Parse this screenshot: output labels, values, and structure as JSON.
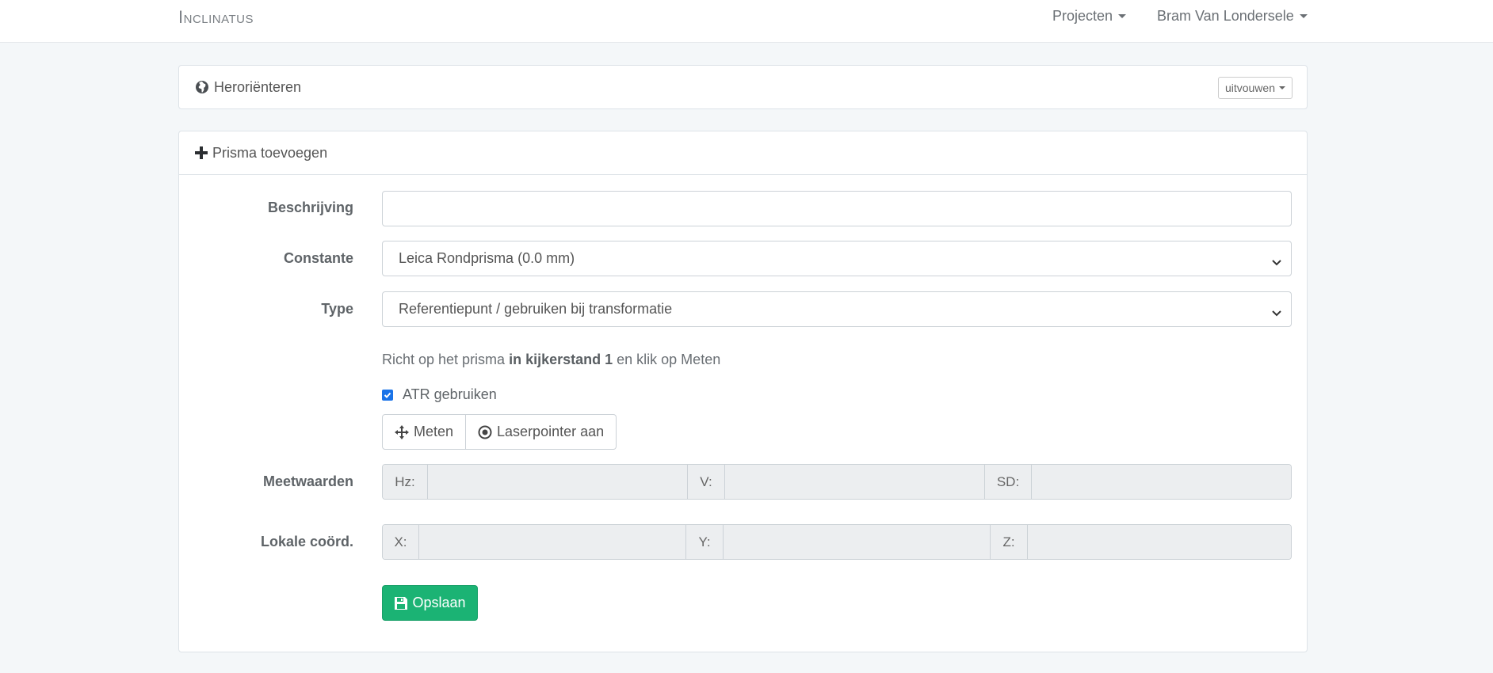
{
  "navbar": {
    "brand": "Inclinatus",
    "projects_label": "Projecten",
    "user_label": "Bram Van Londersele"
  },
  "reorient_panel": {
    "title": "Heroriënteren",
    "expand_label": "uitvouwen"
  },
  "add_prism_panel": {
    "title": "Prisma toevoegen",
    "description": {
      "label": "Beschrijving",
      "value": ""
    },
    "constant": {
      "label": "Constante",
      "selected": "Leica Rondprisma (0.0 mm)"
    },
    "type": {
      "label": "Type",
      "selected": "Referentiepunt / gebruiken bij transformatie"
    },
    "instruction": {
      "prefix": "Richt op het prisma ",
      "emphasis": "in kijkerstand 1",
      "suffix": " en klik op Meten"
    },
    "atr": {
      "label": "ATR gebruiken",
      "checked": true
    },
    "measure_button": "Meten",
    "laser_button": "Laserpointer aan",
    "measurements": {
      "label": "Meetwaarden",
      "hz_label": "Hz:",
      "hz_value": "",
      "v_label": "V:",
      "v_value": "",
      "sd_label": "SD:",
      "sd_value": ""
    },
    "local_coords": {
      "label": "Lokale coörd.",
      "x_label": "X:",
      "x_value": "",
      "y_label": "Y:",
      "y_value": "",
      "z_label": "Z:",
      "z_value": ""
    },
    "save_button": "Opslaan"
  },
  "colors": {
    "background": "#f4f7f9",
    "success": "#1bb374",
    "checkbox": "#1a73e8"
  }
}
